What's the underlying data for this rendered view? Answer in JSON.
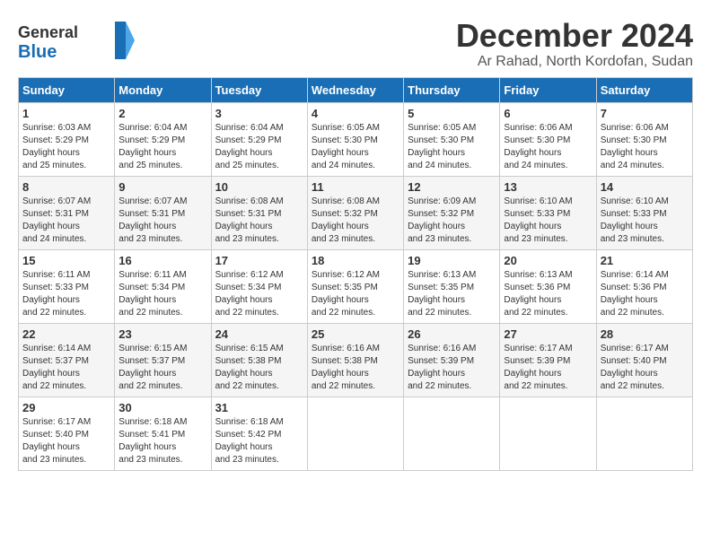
{
  "header": {
    "logo_general": "General",
    "logo_blue": "Blue",
    "month": "December 2024",
    "location": "Ar Rahad, North Kordofan, Sudan"
  },
  "weekdays": [
    "Sunday",
    "Monday",
    "Tuesday",
    "Wednesday",
    "Thursday",
    "Friday",
    "Saturday"
  ],
  "weeks": [
    [
      {
        "day": "1",
        "sunrise": "6:03 AM",
        "sunset": "5:29 PM",
        "daylight": "11 hours and 25 minutes."
      },
      {
        "day": "2",
        "sunrise": "6:04 AM",
        "sunset": "5:29 PM",
        "daylight": "11 hours and 25 minutes."
      },
      {
        "day": "3",
        "sunrise": "6:04 AM",
        "sunset": "5:29 PM",
        "daylight": "11 hours and 25 minutes."
      },
      {
        "day": "4",
        "sunrise": "6:05 AM",
        "sunset": "5:30 PM",
        "daylight": "11 hours and 24 minutes."
      },
      {
        "day": "5",
        "sunrise": "6:05 AM",
        "sunset": "5:30 PM",
        "daylight": "11 hours and 24 minutes."
      },
      {
        "day": "6",
        "sunrise": "6:06 AM",
        "sunset": "5:30 PM",
        "daylight": "11 hours and 24 minutes."
      },
      {
        "day": "7",
        "sunrise": "6:06 AM",
        "sunset": "5:30 PM",
        "daylight": "11 hours and 24 minutes."
      }
    ],
    [
      {
        "day": "8",
        "sunrise": "6:07 AM",
        "sunset": "5:31 PM",
        "daylight": "11 hours and 24 minutes."
      },
      {
        "day": "9",
        "sunrise": "6:07 AM",
        "sunset": "5:31 PM",
        "daylight": "11 hours and 23 minutes."
      },
      {
        "day": "10",
        "sunrise": "6:08 AM",
        "sunset": "5:31 PM",
        "daylight": "11 hours and 23 minutes."
      },
      {
        "day": "11",
        "sunrise": "6:08 AM",
        "sunset": "5:32 PM",
        "daylight": "11 hours and 23 minutes."
      },
      {
        "day": "12",
        "sunrise": "6:09 AM",
        "sunset": "5:32 PM",
        "daylight": "11 hours and 23 minutes."
      },
      {
        "day": "13",
        "sunrise": "6:10 AM",
        "sunset": "5:33 PM",
        "daylight": "11 hours and 23 minutes."
      },
      {
        "day": "14",
        "sunrise": "6:10 AM",
        "sunset": "5:33 PM",
        "daylight": "11 hours and 23 minutes."
      }
    ],
    [
      {
        "day": "15",
        "sunrise": "6:11 AM",
        "sunset": "5:33 PM",
        "daylight": "11 hours and 22 minutes."
      },
      {
        "day": "16",
        "sunrise": "6:11 AM",
        "sunset": "5:34 PM",
        "daylight": "11 hours and 22 minutes."
      },
      {
        "day": "17",
        "sunrise": "6:12 AM",
        "sunset": "5:34 PM",
        "daylight": "11 hours and 22 minutes."
      },
      {
        "day": "18",
        "sunrise": "6:12 AM",
        "sunset": "5:35 PM",
        "daylight": "11 hours and 22 minutes."
      },
      {
        "day": "19",
        "sunrise": "6:13 AM",
        "sunset": "5:35 PM",
        "daylight": "11 hours and 22 minutes."
      },
      {
        "day": "20",
        "sunrise": "6:13 AM",
        "sunset": "5:36 PM",
        "daylight": "11 hours and 22 minutes."
      },
      {
        "day": "21",
        "sunrise": "6:14 AM",
        "sunset": "5:36 PM",
        "daylight": "11 hours and 22 minutes."
      }
    ],
    [
      {
        "day": "22",
        "sunrise": "6:14 AM",
        "sunset": "5:37 PM",
        "daylight": "11 hours and 22 minutes."
      },
      {
        "day": "23",
        "sunrise": "6:15 AM",
        "sunset": "5:37 PM",
        "daylight": "11 hours and 22 minutes."
      },
      {
        "day": "24",
        "sunrise": "6:15 AM",
        "sunset": "5:38 PM",
        "daylight": "11 hours and 22 minutes."
      },
      {
        "day": "25",
        "sunrise": "6:16 AM",
        "sunset": "5:38 PM",
        "daylight": "11 hours and 22 minutes."
      },
      {
        "day": "26",
        "sunrise": "6:16 AM",
        "sunset": "5:39 PM",
        "daylight": "11 hours and 22 minutes."
      },
      {
        "day": "27",
        "sunrise": "6:17 AM",
        "sunset": "5:39 PM",
        "daylight": "11 hours and 22 minutes."
      },
      {
        "day": "28",
        "sunrise": "6:17 AM",
        "sunset": "5:40 PM",
        "daylight": "11 hours and 22 minutes."
      }
    ],
    [
      {
        "day": "29",
        "sunrise": "6:17 AM",
        "sunset": "5:40 PM",
        "daylight": "11 hours and 23 minutes."
      },
      {
        "day": "30",
        "sunrise": "6:18 AM",
        "sunset": "5:41 PM",
        "daylight": "11 hours and 23 minutes."
      },
      {
        "day": "31",
        "sunrise": "6:18 AM",
        "sunset": "5:42 PM",
        "daylight": "11 hours and 23 minutes."
      },
      null,
      null,
      null,
      null
    ]
  ],
  "labels": {
    "sunrise": "Sunrise:",
    "sunset": "Sunset:",
    "daylight": "Daylight hours"
  }
}
